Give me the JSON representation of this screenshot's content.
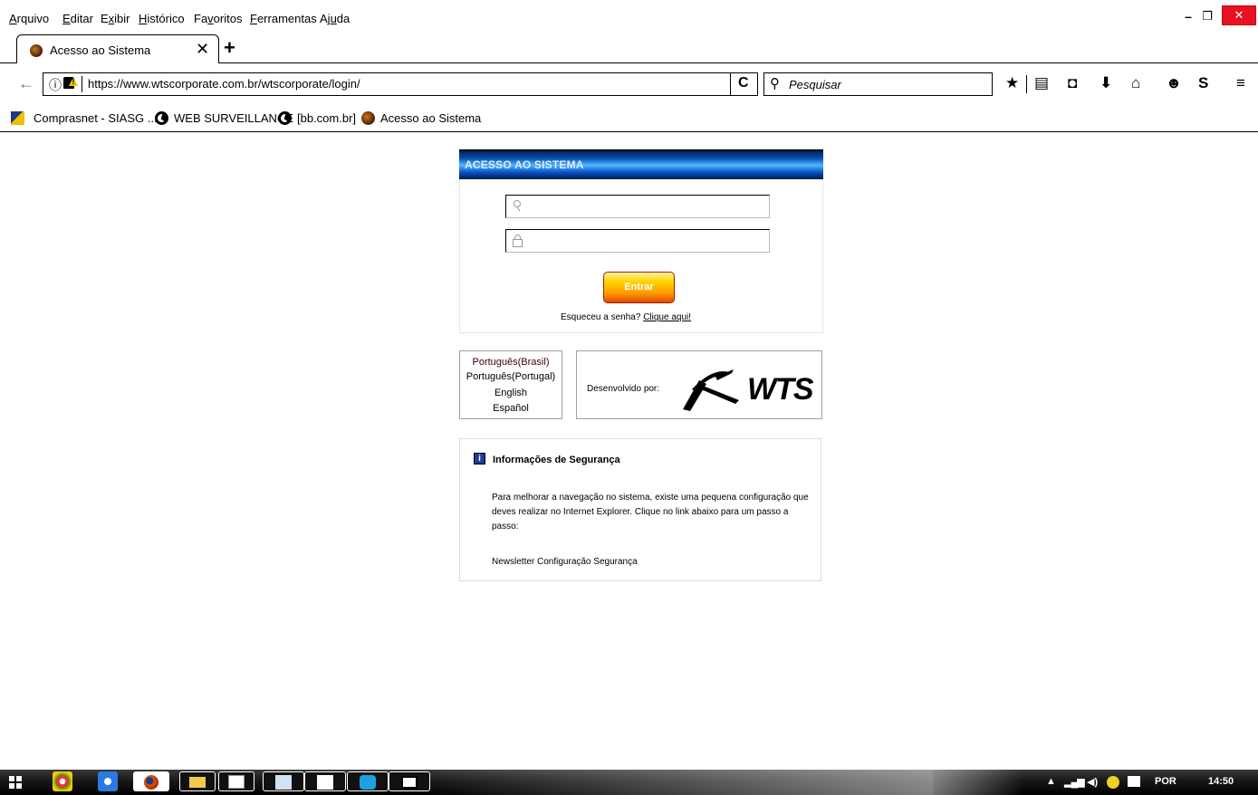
{
  "menu": {
    "items": [
      {
        "pre": "",
        "key": "A",
        "post": "rquivo"
      },
      {
        "pre": "",
        "key": "E",
        "post": "ditar"
      },
      {
        "pre": "E",
        "key": "x",
        "post": "ibir"
      },
      {
        "pre": "",
        "key": "H",
        "post": "istórico"
      },
      {
        "pre": "Fa",
        "key": "v",
        "post": "oritos"
      },
      {
        "pre": "",
        "key": "F",
        "post": "erramentas"
      },
      {
        "pre": "Aj",
        "key": "u",
        "post": "da"
      }
    ]
  },
  "window": {
    "minimize": "–",
    "maximize": "❐",
    "close": "✕"
  },
  "tab": {
    "title": "Acesso ao Sistema",
    "close": "✕",
    "new_tab": "+"
  },
  "navigation": {
    "back": "←",
    "url": "https://www.wtscorporate.com.br/wtscorporate/login/",
    "info": "ⓘ",
    "reload": "C",
    "search_placeholder": "Pesquisar",
    "search_glyph": "⚲"
  },
  "toolbar_icons": [
    {
      "name": "bookmark-star-icon",
      "glyph": "★"
    },
    {
      "name": "reading-list-icon",
      "glyph": "▤"
    },
    {
      "name": "pocket-icon",
      "glyph": "◘"
    },
    {
      "name": "downloads-icon",
      "glyph": "⬇"
    },
    {
      "name": "home-icon",
      "glyph": "⌂"
    },
    {
      "name": "hello-icon",
      "glyph": "☻"
    },
    {
      "name": "skype-icon",
      "glyph": "S"
    },
    {
      "name": "hamburger-menu-icon",
      "glyph": "≡"
    }
  ],
  "bookmarks": [
    {
      "label": "Comprasnet - SIASG ...",
      "icon": "comprasnet-icon"
    },
    {
      "label": "WEB SURVEILLANCE",
      "icon": "globe-icon"
    },
    {
      "label": "[bb.com.br]",
      "icon": "globe-icon"
    },
    {
      "label": "Acesso ao Sistema",
      "icon": "site-favicon-icon"
    }
  ],
  "login": {
    "header": "ACESSO AO SISTEMA",
    "button": "Entrar",
    "forgot_text": "Esqueceu a senha?",
    "forgot_link": "Clique aqui!"
  },
  "languages": [
    "Português(Brasil)",
    "Português(Portugal)",
    "English",
    "Español"
  ],
  "developer": {
    "label": "Desenvolvido por:",
    "logo_text": "WTS"
  },
  "security": {
    "icon": "i",
    "title": "Informações de Segurança",
    "body": "Para melhorar a navegação no sistema, existe uma pequena configuração que deves realizar no Internet Explorer. Clique no link abaixo para um passo a passo:",
    "link": "Newsletter Configuração Segurança"
  },
  "taskbar": {
    "language": "POR",
    "time": "14:50"
  },
  "colors": {
    "header_blue": "#064bb0",
    "button_orange": "#ff9a00",
    "close_red": "#e81123"
  }
}
